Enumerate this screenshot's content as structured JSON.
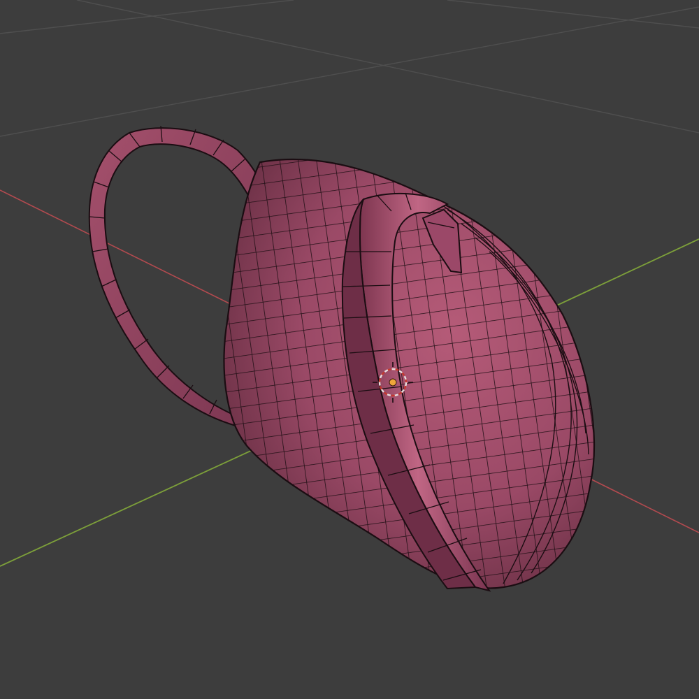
{
  "viewport": {
    "background": "#3d3d3d",
    "grid_color": "#4f4f4f",
    "x_axis_color": "#b34a4f",
    "y_axis_color": "#7da03a",
    "show_grid": true,
    "show_axes": true
  },
  "object": {
    "kind": "bag mesh with shoulder strap and handle",
    "base_color": "#a5506c",
    "wire_color": "#1b0d12",
    "wireframe": true
  },
  "cursor_3d": {
    "icon": "3d-cursor-icon",
    "ring_color_a": "#e9dede",
    "ring_color_b": "#c5382e",
    "center_color": "#f0a63a"
  }
}
